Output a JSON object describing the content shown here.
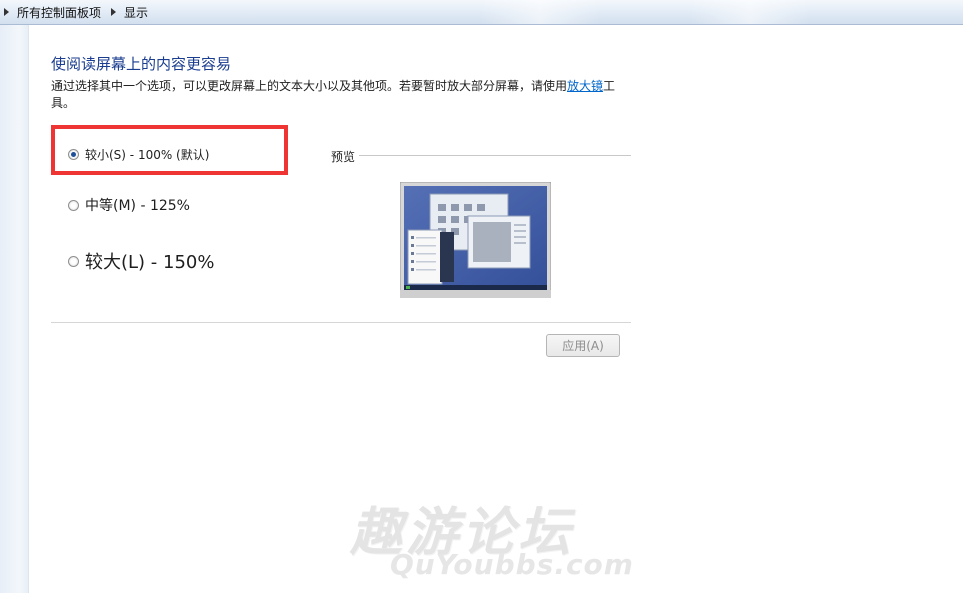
{
  "breadcrumb": {
    "item1": "所有控制面板项",
    "item2": "显示"
  },
  "page": {
    "title": "使阅读屏幕上的内容更容易",
    "description_text": "通过选择其中一个选项，可以更改屏幕上的文本大小以及其他项。若要暂时放大部分屏幕，请使用",
    "magnifier_link": "放大镜",
    "description_tail": "工具。"
  },
  "options": [
    {
      "label": "较小(S) - 100% (默认)",
      "checked": true
    },
    {
      "label": "中等(M) - 125%",
      "checked": false
    },
    {
      "label": "较大(L) - 150%",
      "checked": false
    }
  ],
  "preview": {
    "label": "预览"
  },
  "apply_button": {
    "label": "应用(A)",
    "enabled": false
  },
  "watermark": {
    "cn": "趣游论坛",
    "en": "QuYoubbs.com"
  },
  "colors": {
    "title": "#1a3d8f",
    "link": "#0066cc",
    "highlight": "#ef3434"
  }
}
